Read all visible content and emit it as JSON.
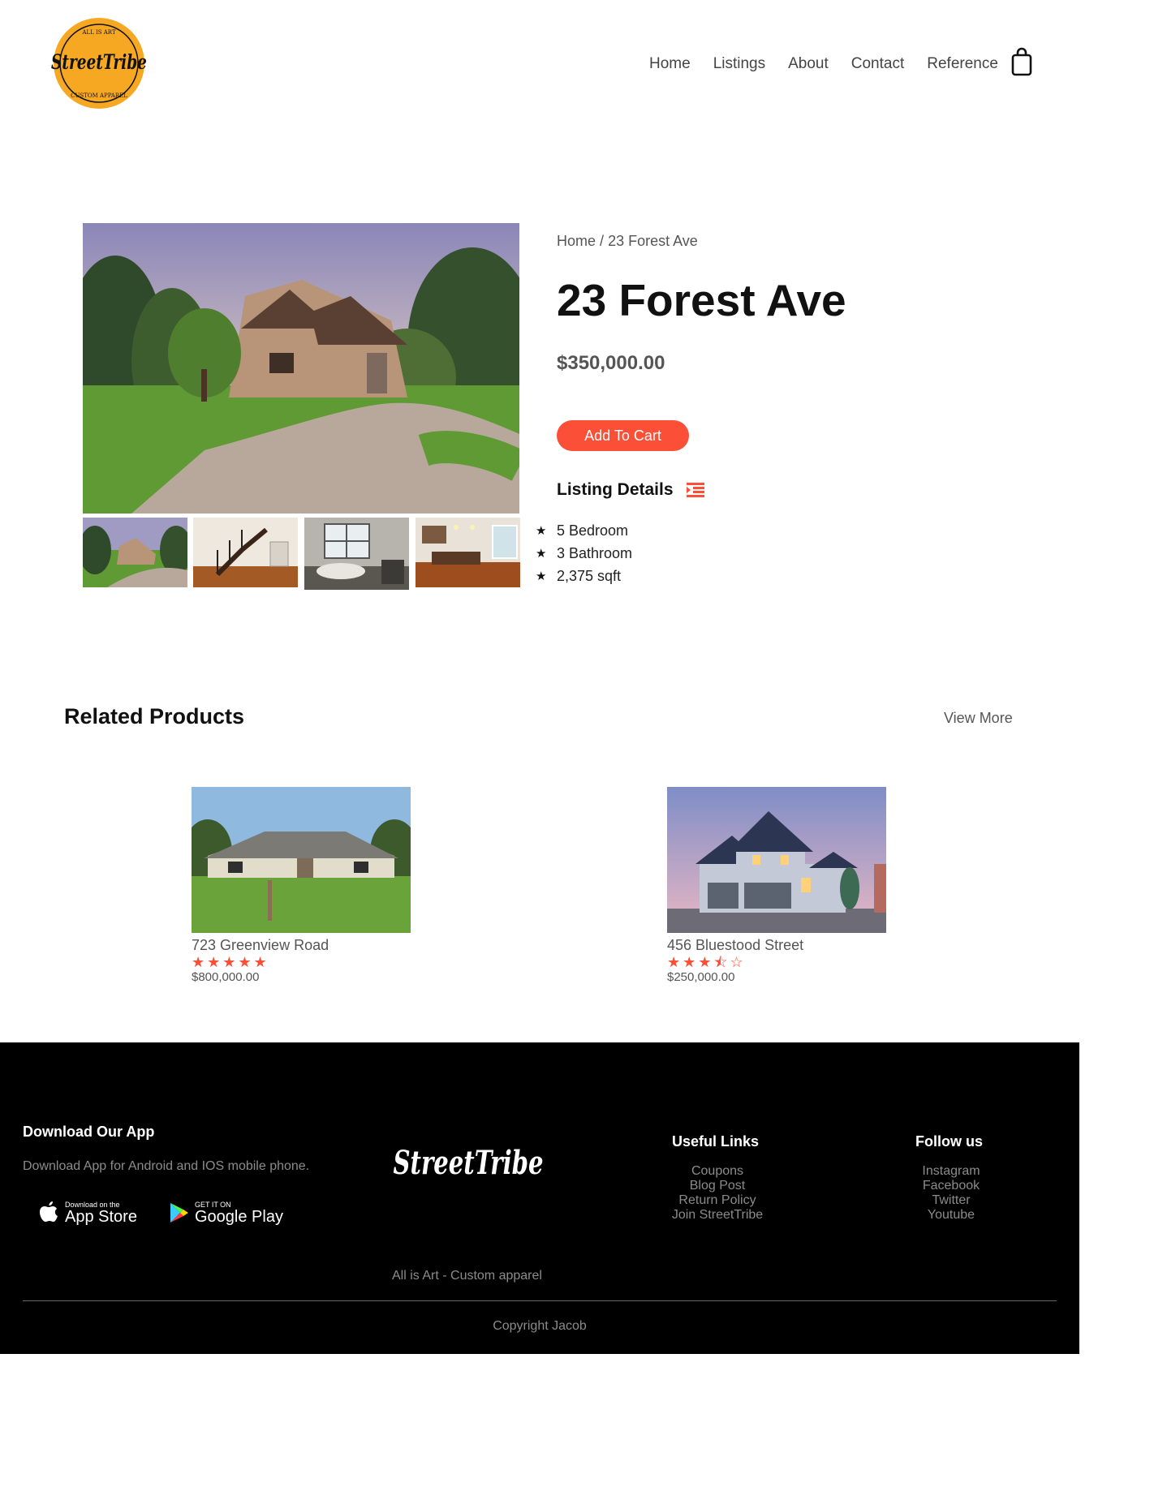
{
  "header": {
    "logo": {
      "ring_top": "ALL IS ART",
      "wordmark": "StreetTribe",
      "ring_bottom": "CUSTOM APPAREL"
    },
    "nav": [
      "Home",
      "Listings",
      "About",
      "Contact",
      "Reference"
    ]
  },
  "product": {
    "breadcrumb": {
      "home": "Home",
      "separator": "/",
      "current": "23 Forest Ave"
    },
    "title": "23 Forest Ave",
    "price": "$350,000.00",
    "add_to_cart": "Add To Cart",
    "details_heading": "Listing Details",
    "details": [
      "5 Bedroom",
      "3 Bathroom",
      "2,375 sqft"
    ]
  },
  "related": {
    "title": "Related Products",
    "view_more": "View More",
    "items": [
      {
        "name": "723 Greenview Road",
        "rating": 5,
        "stars": "★★★★★",
        "price": "$800,000.00"
      },
      {
        "name": "456 Bluestood Street",
        "rating": 3.5,
        "stars": "★★★⯪☆",
        "price": "$250,000.00"
      }
    ]
  },
  "footer": {
    "app": {
      "title": "Download Our App",
      "text": "Download App for Android and IOS mobile phone.",
      "appstore_small": "Download on the",
      "appstore_big": "App Store",
      "google_small": "GET IT ON",
      "google_big": "Google Play"
    },
    "brand": {
      "wordmark": "StreetTribe",
      "tagline": "All is Art - Custom apparel"
    },
    "useful_links": {
      "title": "Useful Links",
      "items": [
        "Coupons",
        "Blog Post",
        "Return Policy",
        "Join StreetTribe"
      ]
    },
    "follow": {
      "title": "Follow us",
      "items": [
        "Instagram",
        "Facebook",
        "Twitter",
        "Youtube"
      ]
    },
    "copyright": "Copyright Jacob"
  },
  "colors": {
    "accent": "#fb4f38",
    "logo_yellow": "#f7a823",
    "footer_bg": "#000000"
  }
}
